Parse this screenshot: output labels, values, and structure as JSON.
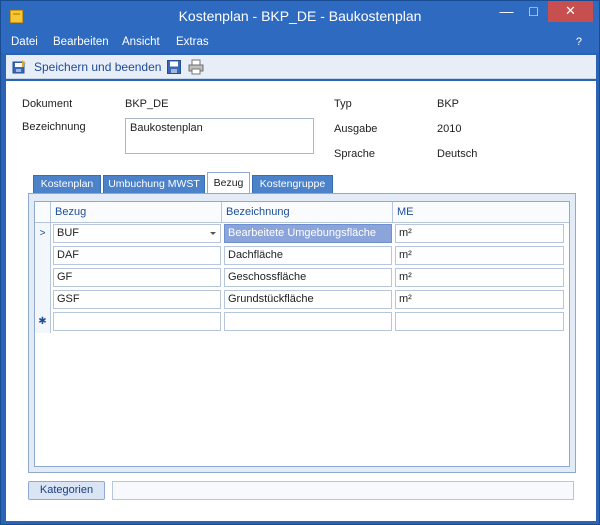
{
  "window": {
    "title": "Kostenplan - BKP_DE - Baukostenplan",
    "min": "—",
    "max": "□",
    "close": "✕"
  },
  "menu": {
    "items": [
      "Datei",
      "Bearbeiten",
      "Ansicht",
      "Extras"
    ],
    "help": "?"
  },
  "toolbar": {
    "save_close_label": "Speichern und beenden"
  },
  "form": {
    "dokument_label": "Dokument",
    "dokument_value": "BKP_DE",
    "bezeichnung_label": "Bezeichnung",
    "bezeichnung_value": "Baukostenplan",
    "typ_label": "Typ",
    "typ_value": "BKP",
    "ausgabe_label": "Ausgabe",
    "ausgabe_value": "2010",
    "sprache_label": "Sprache",
    "sprache_value": "Deutsch"
  },
  "tabs": [
    "Kostenplan",
    "Umbuchung MWST",
    "Bezug",
    "Kostengruppe"
  ],
  "active_tab": "Bezug",
  "grid": {
    "columns": [
      "Bezug",
      "Bezeichnung",
      "ME"
    ],
    "current_row_marker": ">",
    "new_row_marker": "✱",
    "rows": [
      {
        "bezug": "BUF",
        "bezeichnung": "Bearbeitete Umgebungsfläche",
        "me": "m²"
      },
      {
        "bezug": "DAF",
        "bezeichnung": "Dachfläche",
        "me": "m²"
      },
      {
        "bezug": "GF",
        "bezeichnung": "Geschossfläche",
        "me": "m²"
      },
      {
        "bezug": "GSF",
        "bezeichnung": "Grundstückfläche",
        "me": "m²"
      }
    ]
  },
  "bottom": {
    "kategorien_label": "Kategorien"
  },
  "colors": {
    "title_bar": "#2e6ac0",
    "close_button": "#c74f4f",
    "selected_cell": "#8ba4d9",
    "tab": "#4c82c9"
  }
}
